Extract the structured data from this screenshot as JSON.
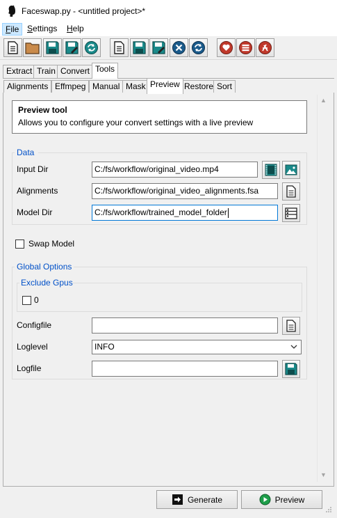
{
  "window": {
    "title": "Faceswap.py - <untitled project>*"
  },
  "menu": {
    "items": [
      "File",
      "Settings",
      "Help"
    ],
    "mnemonics": [
      "F",
      "S",
      "H"
    ],
    "active": "File"
  },
  "toolbar": {
    "icons": [
      "new-document-icon",
      "open-folder-icon",
      "save-icon",
      "save-as-icon",
      "reload-icon",
      "new-document-icon",
      "save-icon",
      "save-as-icon",
      "close-circle-icon",
      "reload-icon",
      "donate-icon",
      "list-icon",
      "github-icon"
    ]
  },
  "tabs": {
    "main": [
      "Extract",
      "Train",
      "Convert",
      "Tools"
    ],
    "main_selected": "Tools",
    "tools": [
      "Alignments",
      "Effmpeg",
      "Manual",
      "Mask",
      "Preview",
      "Restore",
      "Sort"
    ],
    "tools_selected": "Preview"
  },
  "info": {
    "heading": "Preview tool",
    "description": "Allows you to configure your convert settings with a live preview"
  },
  "data_group": {
    "title": "Data",
    "input_dir": {
      "label": "Input Dir",
      "value": "C:/fs/workflow/original_video.mp4"
    },
    "alignments": {
      "label": "Alignments",
      "value": "C:/fs/workflow/original_video_alignments.fsa"
    },
    "model_dir": {
      "label": "Model Dir",
      "value": "C:/fs/workflow/trained_model_folder"
    }
  },
  "swap_model": {
    "label": "Swap Model",
    "checked": false
  },
  "global_options": {
    "title": "Global Options",
    "exclude_gpus": {
      "title": "Exclude Gpus",
      "option": "0",
      "checked": false
    },
    "configfile": {
      "label": "Configfile",
      "value": ""
    },
    "loglevel": {
      "label": "Loglevel",
      "value": "INFO"
    },
    "logfile": {
      "label": "Logfile",
      "value": ""
    }
  },
  "actions": {
    "generate": "Generate",
    "preview": "Preview"
  },
  "colors": {
    "accent_blue": "#0050c8",
    "focus_blue": "#0078d7",
    "icon_teal": "#1a8a8a",
    "icon_red": "#c0392b",
    "preview_green": "#1e9e4a"
  }
}
